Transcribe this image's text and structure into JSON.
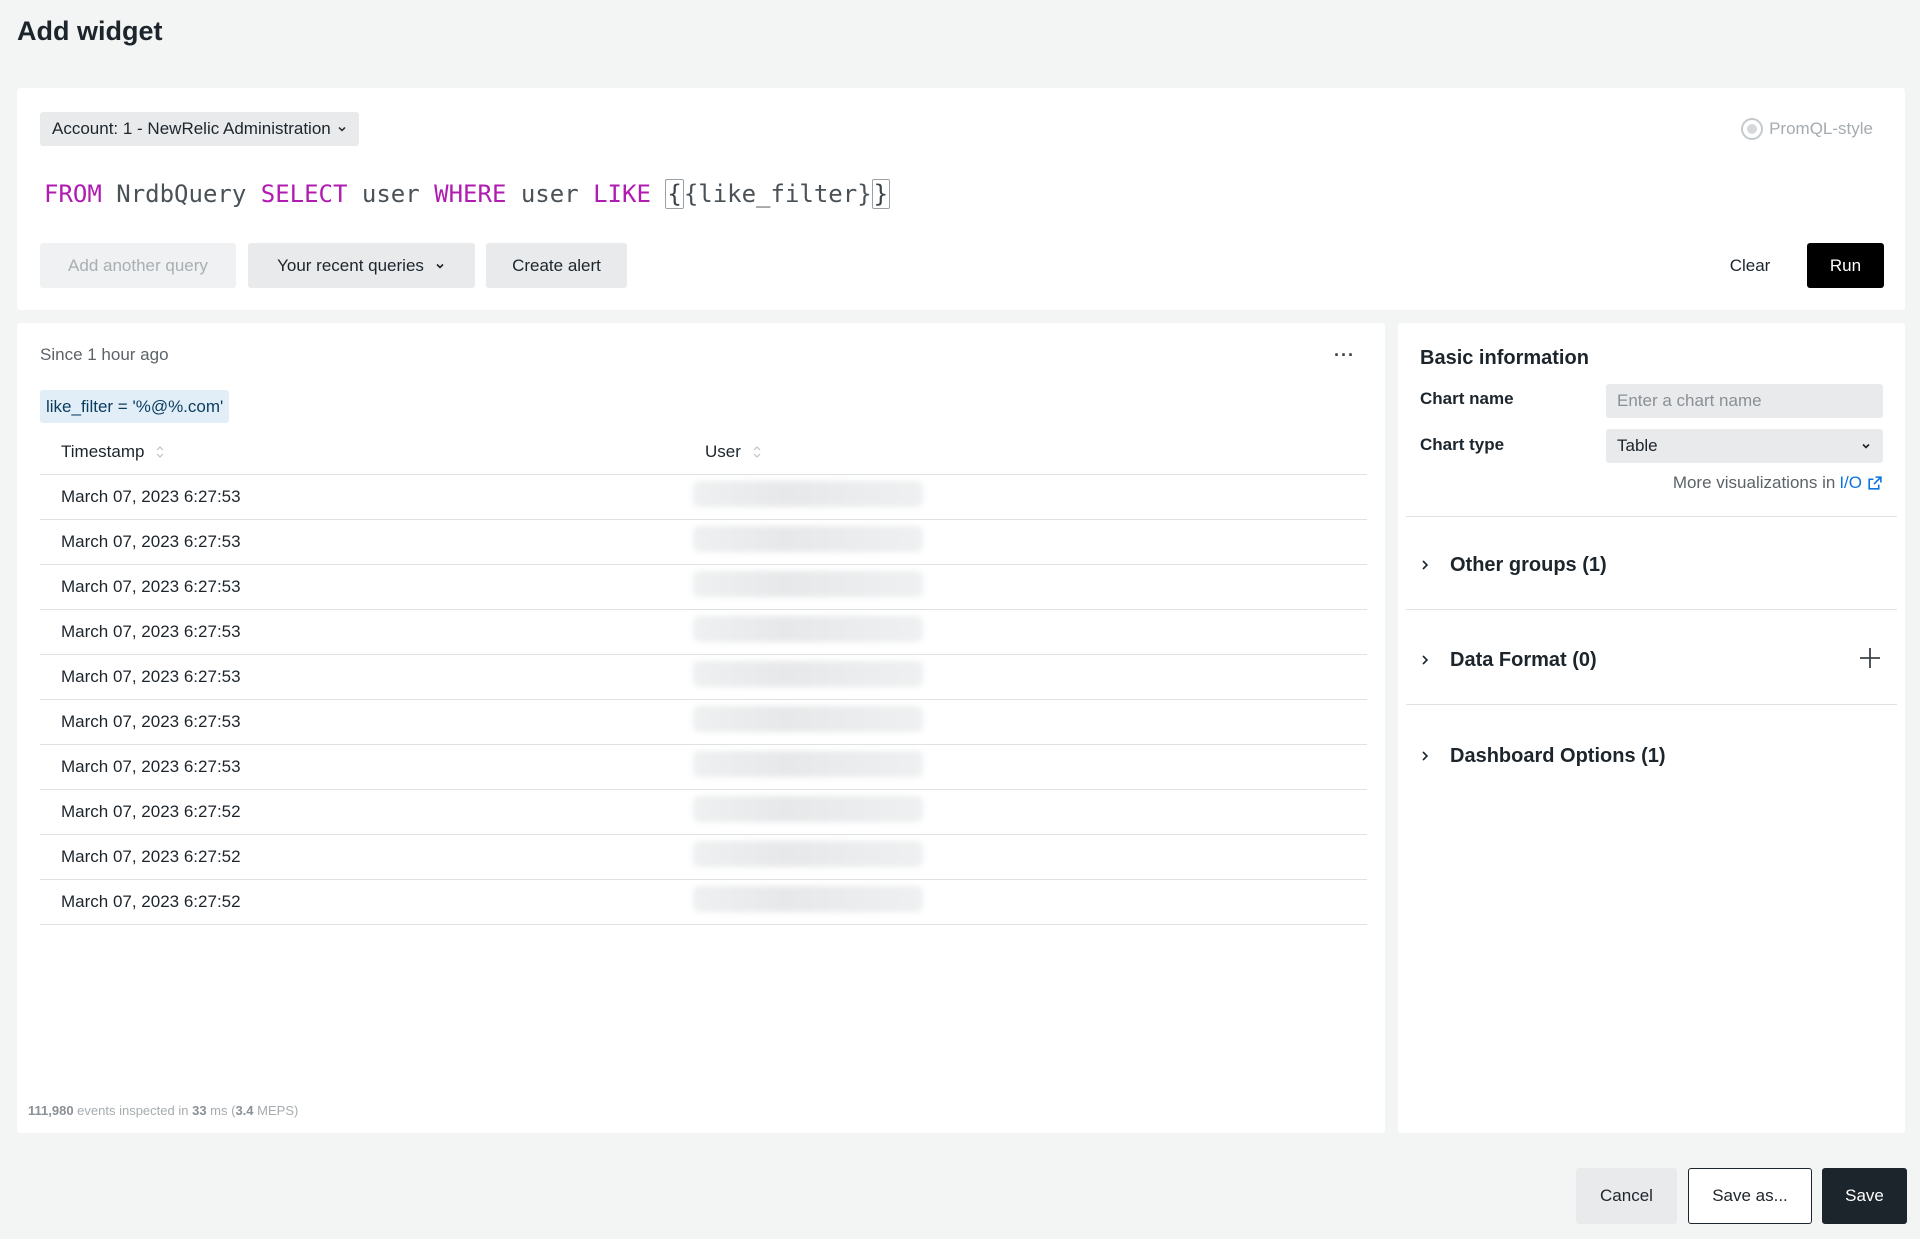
{
  "page": {
    "title": "Add widget"
  },
  "query": {
    "account_label": "Account: 1 - NewRelic Administration",
    "promql_label": "PromQL-style",
    "nrql": {
      "kw_from": "FROM",
      "source": " NrdbQuery ",
      "kw_select": "SELECT",
      "field": " user ",
      "kw_where": "WHERE",
      "field2": " user ",
      "kw_like": "LIKE",
      "space": " ",
      "brace_open": "{",
      "variable": "{like_filter}",
      "brace_close": "}"
    },
    "add_query_label": "Add another query",
    "recent_queries_label": "Your recent queries",
    "create_alert_label": "Create alert",
    "clear_label": "Clear",
    "run_label": "Run"
  },
  "results": {
    "since_label": "Since 1 hour ago",
    "more_label": "···",
    "filter_chip": "like_filter = '%@%.com'",
    "columns": [
      "Timestamp",
      "User"
    ],
    "rows": [
      "March 07, 2023 6:27:53",
      "March 07, 2023 6:27:53",
      "March 07, 2023 6:27:53",
      "March 07, 2023 6:27:53",
      "March 07, 2023 6:27:53",
      "March 07, 2023 6:27:53",
      "March 07, 2023 6:27:53",
      "March 07, 2023 6:27:52",
      "March 07, 2023 6:27:52",
      "March 07, 2023 6:27:52"
    ],
    "footer": {
      "events": "111,980",
      "events_text": " events inspected in ",
      "ms": "33",
      "ms_text": " ms (",
      "meps": "3.4",
      "meps_text": " MEPS)"
    }
  },
  "side": {
    "title": "Basic information",
    "chart_name_label": "Chart name",
    "chart_name_placeholder": "Enter a chart name",
    "chart_type_label": "Chart type",
    "chart_type_value": "Table",
    "more_viz_text": "More visualizations in",
    "more_viz_link": "I/O",
    "sections": [
      "Other groups (1)",
      "Data Format (0)",
      "Dashboard Options (1)"
    ]
  },
  "footer": {
    "cancel_label": "Cancel",
    "save_as_label": "Save as...",
    "save_label": "Save"
  },
  "colors": {
    "keyword": "#b01bb1",
    "run_button": "#000000",
    "save_button": "#1d252c",
    "link": "#0c74df",
    "filter_chip_bg": "#e1eef8"
  }
}
